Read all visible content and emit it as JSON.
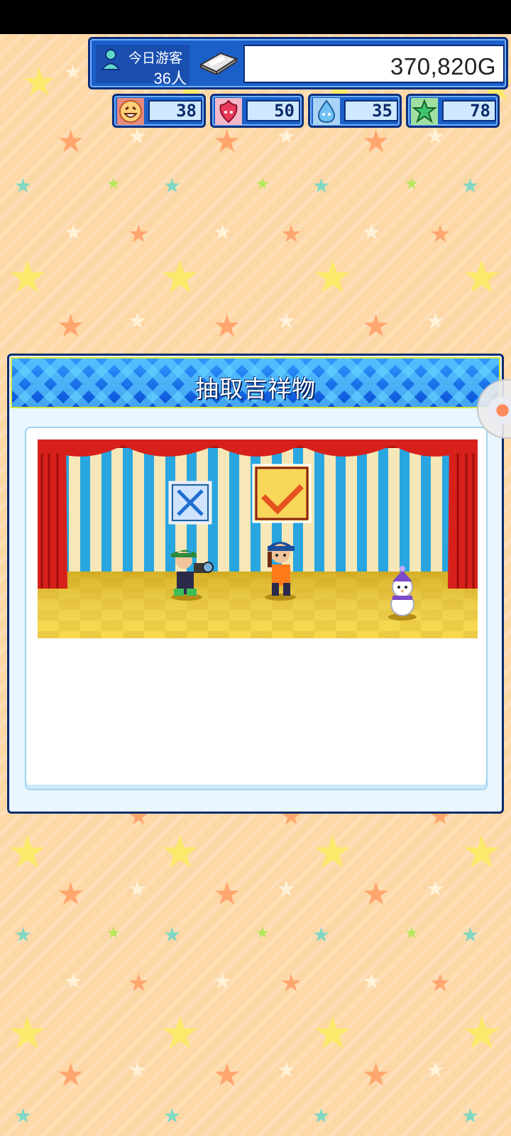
{
  "hud": {
    "visitors_label": "今日游客",
    "visitors_count": "36人",
    "money": "370,820G"
  },
  "stats": [
    {
      "icon": "smile-face-icon",
      "value": "38"
    },
    {
      "icon": "fire-spirit-icon",
      "value": "50"
    },
    {
      "icon": "water-drop-icon",
      "value": "35"
    },
    {
      "icon": "green-star-icon",
      "value": "78"
    }
  ],
  "dialog": {
    "title": "抽取吉祥物"
  },
  "stage": {
    "marks": [
      "cross-mark-icon",
      "check-mark-icon"
    ],
    "characters": [
      "cameraman-character",
      "performer-character",
      "snowman-mascot"
    ]
  },
  "colors": {
    "background": "#fdd7a6",
    "hud_blue": "#1b60c9",
    "header_blue": "#1b7bf0",
    "curtain_red": "#d8201b",
    "floor_yellow": "#f6d640"
  }
}
